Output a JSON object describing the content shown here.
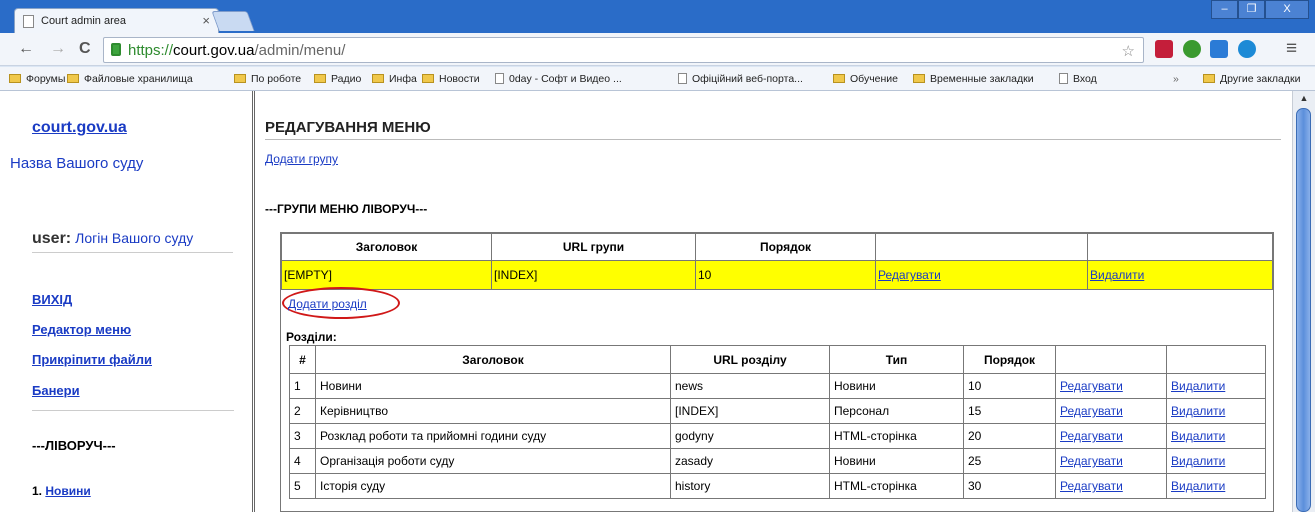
{
  "browser": {
    "tab_title": "Court admin area",
    "tab_close": "×",
    "url_proto": "https://",
    "url_host": "court.gov.ua",
    "url_path": "/admin/menu/",
    "window_controls": {
      "minimize": "–",
      "restore": "❐",
      "close": "X"
    },
    "nav": {
      "back": "←",
      "forward": "→",
      "reload": "C",
      "star": "☆",
      "menu": "≡",
      "overflow": "»"
    },
    "bookmarks": [
      {
        "label": "Форумы",
        "kind": "folder"
      },
      {
        "label": "Файловые хранилища",
        "kind": "folder"
      },
      {
        "label": "По роботе",
        "kind": "folder"
      },
      {
        "label": "Радио",
        "kind": "folder"
      },
      {
        "label": "Инфа",
        "kind": "folder"
      },
      {
        "label": "Новости",
        "kind": "folder"
      },
      {
        "label": "0day - Софт и Видео ...",
        "kind": "page"
      },
      {
        "label": "Офіційний веб-порта...",
        "kind": "page"
      },
      {
        "label": "Обучение",
        "kind": "folder"
      },
      {
        "label": "Временные закладки",
        "kind": "folder"
      },
      {
        "label": "Вход",
        "kind": "page"
      }
    ],
    "other_bookmarks": "Другие закладки"
  },
  "sidebar": {
    "site_link": "court.gov.ua",
    "court_name": "Назва Вашого суду",
    "user_label": "user:",
    "login": "Логін Вашого суду",
    "links": [
      "ВИХІД",
      "Редактор меню",
      "Прикріпити файли",
      "Банери"
    ],
    "section_heading": "---ЛІВОРУЧ---",
    "item_number": "1.",
    "item_label": "Новини"
  },
  "main": {
    "title": "РЕДАГУВАННЯ МЕНЮ",
    "add_group": "Додати групу",
    "groups_heading": "---ГРУПИ МЕНЮ ЛІВОРУЧ---",
    "group_headers": [
      "Заголовок",
      "URL групи",
      "Порядок",
      "",
      ""
    ],
    "group_row": {
      "title": "[EMPTY]",
      "url": "[INDEX]",
      "order": "10",
      "edit": "Редагувати",
      "delete": "Видалити"
    },
    "add_section": "Додати розділ",
    "sections_label": "Розділи:",
    "section_headers": [
      "#",
      "Заголовок",
      "URL розділу",
      "Тип",
      "Порядок",
      "",
      ""
    ],
    "sections": [
      {
        "n": "1",
        "title": "Новини",
        "url": "news",
        "type": "Новини",
        "order": "10",
        "edit": "Редагувати",
        "delete": "Видалити"
      },
      {
        "n": "2",
        "title": "Керівництво",
        "url": "[INDEX]",
        "type": "Персонал",
        "order": "15",
        "edit": "Редагувати",
        "delete": "Видалити"
      },
      {
        "n": "3",
        "title": "Розклад роботи та прийомні години суду",
        "url": "godyny",
        "type": "HTML-сторінка",
        "order": "20",
        "edit": "Редагувати",
        "delete": "Видалити"
      },
      {
        "n": "4",
        "title": "Організація роботи суду",
        "url": "zasady",
        "type": "Новини",
        "order": "25",
        "edit": "Редагувати",
        "delete": "Видалити"
      },
      {
        "n": "5",
        "title": "Історія суду",
        "url": "history",
        "type": "HTML-сторінка",
        "order": "30",
        "edit": "Редагувати",
        "delete": "Видалити"
      }
    ]
  },
  "colors": {
    "link": "#1a3bc4",
    "highlight_row": "#ffff00",
    "annotation_circle": "#d01818",
    "tabbar": "#2a6cc8"
  }
}
